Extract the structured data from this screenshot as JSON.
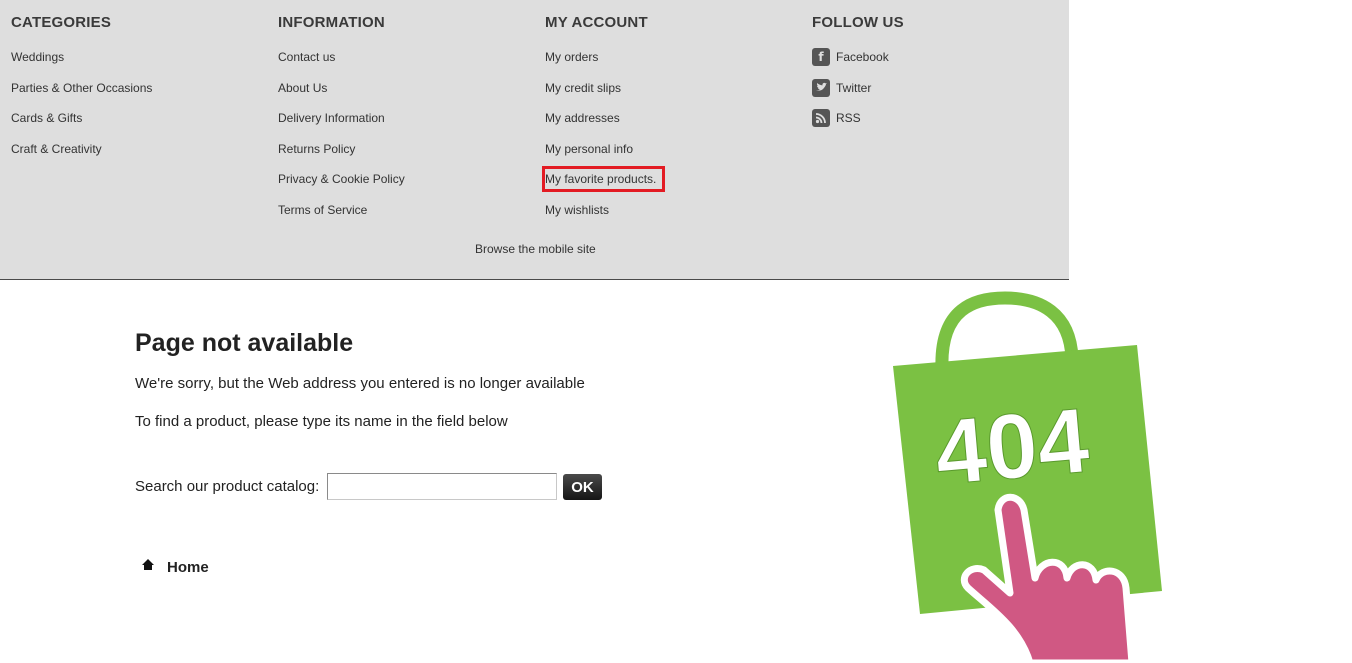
{
  "footer": {
    "columns": [
      {
        "heading": "CATEGORIES",
        "links": [
          "Weddings",
          "Parties & Other Occasions",
          "Cards & Gifts",
          "Craft & Creativity"
        ]
      },
      {
        "heading": "INFORMATION",
        "links": [
          "Contact us",
          "About Us",
          "Delivery Information",
          "Returns Policy",
          "Privacy & Cookie Policy",
          "Terms of Service"
        ]
      },
      {
        "heading": "MY ACCOUNT",
        "links": [
          "My orders",
          "My credit slips",
          "My addresses",
          "My personal info",
          "My favorite products.",
          "My wishlists"
        ],
        "highlighted_link": "My favorite products.",
        "highlight_color": "#e31b23"
      },
      {
        "heading": "FOLLOW US",
        "links": [
          {
            "label": "Facebook",
            "icon": "facebook-icon"
          },
          {
            "label": "Twitter",
            "icon": "twitter-icon"
          },
          {
            "label": "RSS",
            "icon": "rss-icon"
          }
        ]
      }
    ],
    "mobile_link": "Browse the mobile site"
  },
  "main": {
    "title": "Page not available",
    "message_1": "We're sorry, but the Web address you entered is no longer available",
    "message_2": "To find a product, please type its name in the field below",
    "search": {
      "label": "Search our product catalog:",
      "value": "",
      "button_label": "OK"
    },
    "home_link": "Home"
  },
  "illustration": {
    "text": "404",
    "bag_color": "#7bc143",
    "hand_color": "#d05883"
  },
  "colors": {
    "footer_bg": "#dedede",
    "button_bg": "#222222"
  }
}
